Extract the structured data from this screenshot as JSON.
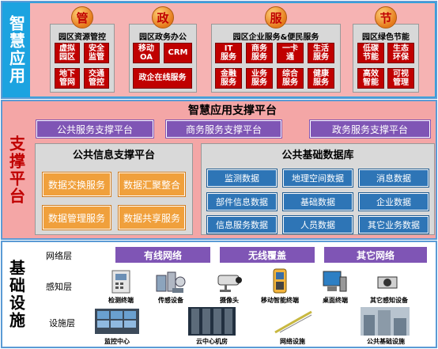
{
  "smart_apps": {
    "side_label": "智慧应用",
    "groups": [
      {
        "category": "管",
        "title": "园区资源管控",
        "items": [
          "虚拟园区",
          "安全监管",
          "地下管网",
          "交通管控"
        ]
      },
      {
        "category": "政",
        "title": "园区政务办公",
        "items": [
          "移动OA",
          "CRM",
          "政企在线服务"
        ]
      },
      {
        "category": "服",
        "title": "园区企业服务&便民服务",
        "items": [
          "IT服务",
          "商务服务",
          "一卡通",
          "生活服务",
          "金融服务",
          "业务服务",
          "综合服务",
          "健康服务"
        ]
      },
      {
        "category": "节",
        "title": "园区绿色节能",
        "items": [
          "低碳节能",
          "生态环保",
          "高效智能",
          "可视管理"
        ]
      }
    ]
  },
  "support": {
    "side_label": "支撑平台",
    "title": "智慧应用支撑平台",
    "services": [
      "公共服务支撑平台",
      "商务服务支撑平台",
      "政务服务支撑平台"
    ],
    "info_platform": {
      "title": "公共信息支撑平台",
      "items": [
        "数据交换服务",
        "数据汇聚整合",
        "数据管理服务",
        "数据共享服务"
      ]
    },
    "database": {
      "title": "公共基础数据库",
      "items": [
        "监测数据",
        "地理空间数据",
        "消息数据",
        "部件信息数据",
        "基础数据",
        "企业数据",
        "信息服务数据",
        "人员数据",
        "其它业务数据"
      ]
    }
  },
  "infrastructure": {
    "side_label": "基础设施",
    "network_label": "网络层",
    "network_items": [
      "有线网络",
      "无线覆盖",
      "其它网络"
    ],
    "sensing_label": "感知层",
    "sensing_items": [
      "检测终端",
      "传感设备",
      "摄像头",
      "移动智能终端",
      "桌面终端",
      "其它感知设备"
    ],
    "facility_label": "设施层",
    "facility_items": [
      "监控中心",
      "云中心机房",
      "网络设施",
      "公共基础设施"
    ]
  },
  "colors": {
    "apps_bg": "#1ca3e0",
    "support_bg": "#f4a6a6",
    "infra_bg": "#ffffff",
    "category_text": "#c00000",
    "service_btn": "#7f55b5",
    "info_item": "#f0a03c",
    "db_item": "#2e75b6"
  }
}
